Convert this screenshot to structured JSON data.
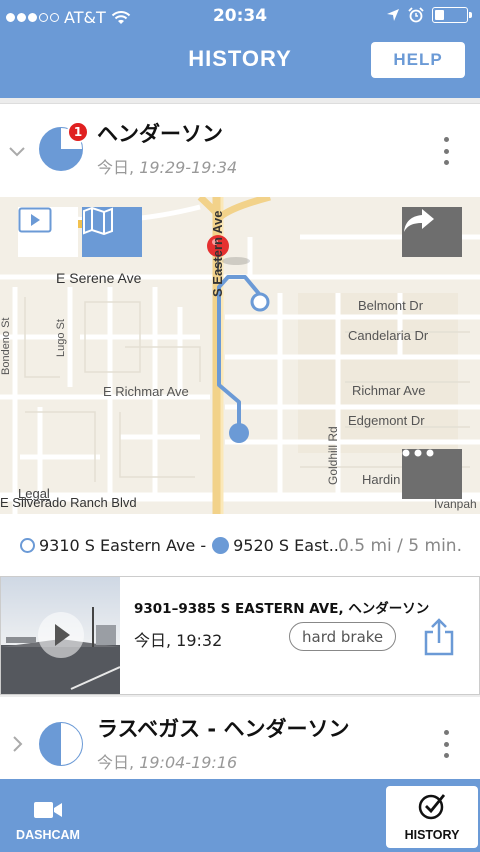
{
  "status_bar": {
    "carrier": "AT&T",
    "time": "20:34"
  },
  "header": {
    "title": "HISTORY",
    "help_label": "HELP"
  },
  "trips": [
    {
      "name": "ヘンダーソン",
      "day": "今日,",
      "range": "19:29-19:34",
      "badge": "1"
    },
    {
      "name": "ラスベガス - ヘンダーソン",
      "day": "今日,",
      "range": "19:04-19:16"
    }
  ],
  "map": {
    "streets": {
      "serene": "E Serene Ave",
      "eastern": "S Eastern Ave",
      "belmont": "Belmont Dr",
      "candelaria": "Candelaria Dr",
      "richmar_w": "E Richmar Ave",
      "richmar_e": "Richmar Ave",
      "edgemont": "Edgemont Dr",
      "hardin": "Hardin Dr",
      "goldhill": "Goldhill Rd",
      "bondeno": "Bondeno St",
      "lugo": "Lugo St",
      "silverado": "E Silverado Ranch Blvd",
      "ivanpah": "Ivanpah",
      "legal": "Legal"
    },
    "colors": {
      "route": "#6b9ad6",
      "pin": "#e53030",
      "road_major": "#f2d28a"
    }
  },
  "route_summary": {
    "start": "9310 S Eastern Ave -",
    "end": "9520 S East...",
    "distance": "0.5 mi / 5 min."
  },
  "event": {
    "address": "9301–9385 S EASTERN AVE, ヘンダーソン",
    "time": "今日, 19:32",
    "tag": "hard brake"
  },
  "tabs": {
    "dashcam": "DASHCAM",
    "history": "HISTORY"
  }
}
